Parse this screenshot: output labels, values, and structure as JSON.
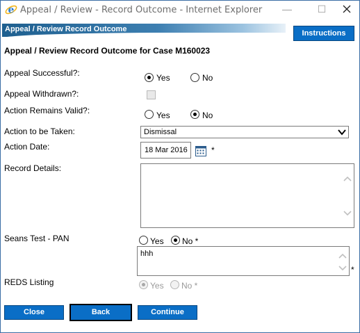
{
  "window": {
    "title": "Appeal / Review - Record Outcome - Internet Explorer",
    "minimize": "—",
    "maximize": "☐"
  },
  "section": {
    "label": "Appeal / Review Record Outcome"
  },
  "toolbar": {
    "instructions_label": "Instructions"
  },
  "page": {
    "title": "Appeal / Review Record Outcome for Case M160023"
  },
  "form": {
    "appeal_successful": {
      "label": "Appeal Successful?:",
      "yes": "Yes",
      "no": "No",
      "selected": "Yes"
    },
    "appeal_withdrawn": {
      "label": "Appeal Withdrawn?:",
      "checked": false,
      "disabled": true
    },
    "action_remains_valid": {
      "label": "Action Remains Valid?:",
      "yes": "Yes",
      "no": "No",
      "selected": "No"
    },
    "action_to_be_taken": {
      "label": "Action to be Taken:",
      "value": "Dismissal"
    },
    "action_date": {
      "label": "Action Date:",
      "value": "18 Mar 2016",
      "required": "*"
    },
    "record_details": {
      "label": "Record Details:",
      "value": ""
    },
    "seans_test": {
      "label": "Seans Test - PAN",
      "yes": "Yes",
      "no": "No *",
      "selected": "No",
      "text": "hhh",
      "required": "*"
    },
    "reds_listing": {
      "label": "REDS Listing",
      "yes": "Yes",
      "no": "No *",
      "selected": "Yes",
      "disabled": true
    }
  },
  "buttons": {
    "close": "Close",
    "back": "Back",
    "continue": "Continue"
  },
  "colors": {
    "accent": "#0a6ec6",
    "header_blue": "#1e5f8f"
  }
}
